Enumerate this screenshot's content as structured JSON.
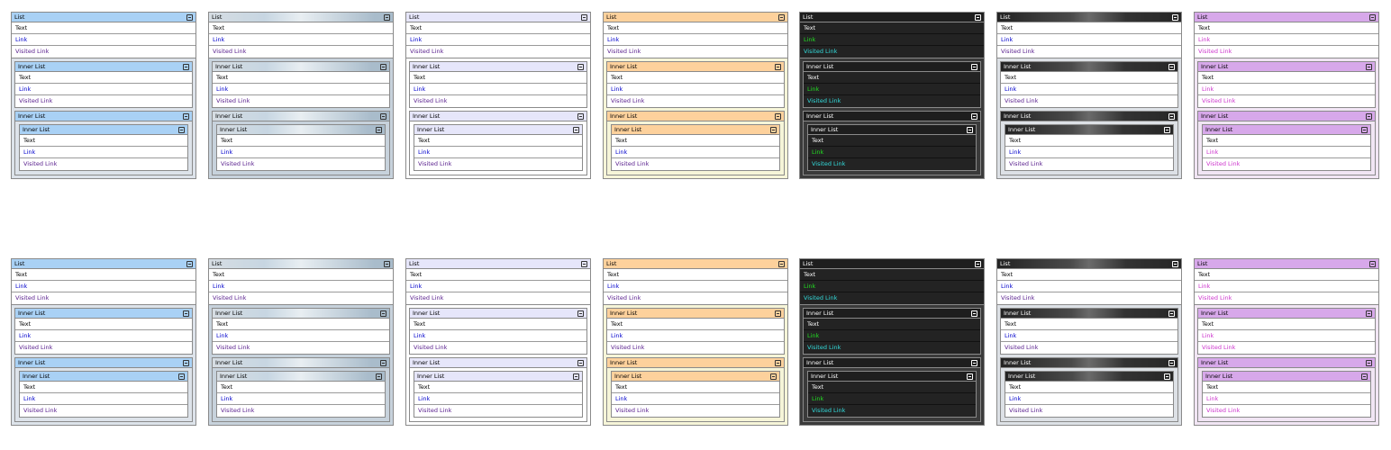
{
  "labels": {
    "list_title": "List",
    "inner_title": "Inner List",
    "text_item": "Text",
    "link_item": "Link",
    "visited_item": "Visited Link"
  },
  "rows": 2,
  "themes": [
    {
      "name": "blue",
      "header_bg": "#a9d1f5",
      "header_fg": "#000000",
      "outer_bg": "#dde3ea",
      "inner_bg": "#ffffff",
      "text": "#000000",
      "link": "#0000cc",
      "visited": "#551a8b",
      "icon": "#333333",
      "mid_bg": "#dde3ea"
    },
    {
      "name": "silver",
      "header_bg": "linear-gradient(90deg,#d6dde3,#c7d6e2 30%,#e8eef2 50%,#a9bccb 90%)",
      "header_fg": "#000000",
      "outer_bg": "#c7d2dc",
      "inner_bg": "#ffffff",
      "text": "#000000",
      "link": "#0000cc",
      "visited": "#551a8b",
      "icon": "#333333",
      "mid_bg": "#c7d2dc"
    },
    {
      "name": "lavender",
      "header_bg": "#e6e6fa",
      "header_fg": "#000000",
      "outer_bg": "#ffffff",
      "inner_bg": "#ffffff",
      "text": "#000000",
      "link": "#0000cc",
      "visited": "#551a8b",
      "icon": "#333333",
      "mid_bg": "#ffffff"
    },
    {
      "name": "orange",
      "header_bg": "#fdd19c",
      "header_fg": "#000000",
      "outer_bg": "#f6f5d8",
      "inner_bg": "#ffffff",
      "text": "#000000",
      "link": "#0000cc",
      "visited": "#551a8b",
      "icon": "#333333",
      "mid_bg": "#f6f5d8"
    },
    {
      "name": "dark",
      "header_bg": "#1e1e1e",
      "header_fg": "#ffffff",
      "outer_bg": "#3a3a3a",
      "inner_bg": "#232323",
      "text": "#ffffff",
      "link": "#22dd22",
      "visited": "#33dddd",
      "icon": "#ffffff",
      "mid_bg": "#3a3a3a",
      "dark": true
    },
    {
      "name": "graphite",
      "header_bg": "linear-gradient(90deg,#232323,#4a4a4a 40%,#6a6a6a 50%,#333333 70%,#262626)",
      "header_fg": "#ffffff",
      "outer_bg": "#dde1e6",
      "inner_bg": "#ffffff",
      "text": "#000000",
      "link": "#0000cc",
      "visited": "#551a8b",
      "icon": "#ffffff",
      "mid_bg": "#dde1e6"
    },
    {
      "name": "purple",
      "header_bg": "#d7a8ea",
      "header_fg": "#000000",
      "outer_bg": "#f1e5f4",
      "inner_bg": "#ffffff",
      "text": "#000000",
      "link": "#cc33cc",
      "visited": "#cc33cc",
      "icon": "#333333",
      "mid_bg": "#f1e5f4"
    }
  ]
}
